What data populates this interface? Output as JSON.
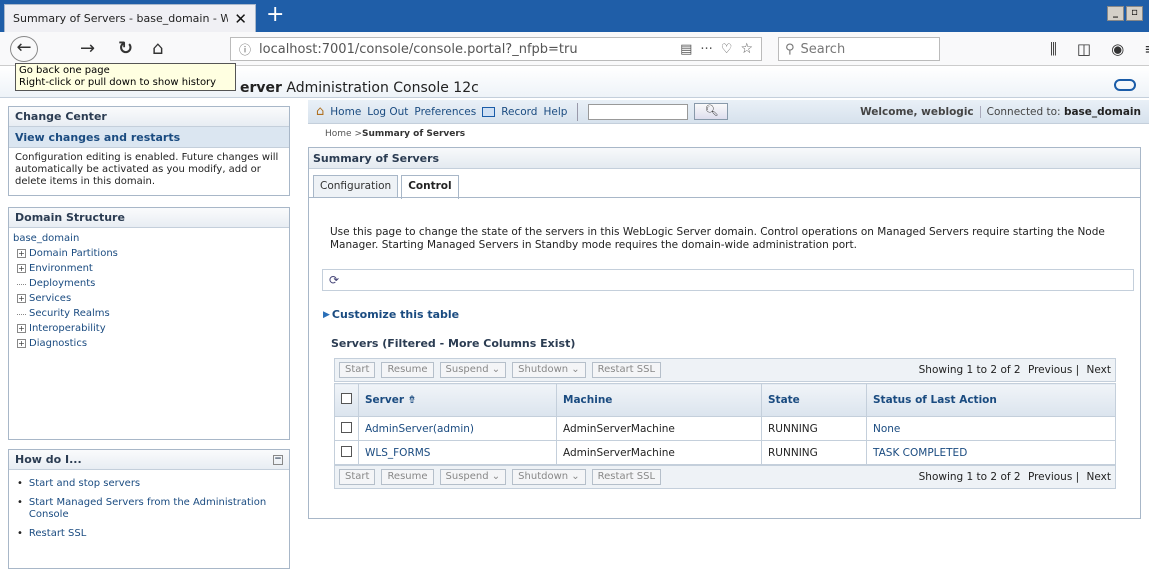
{
  "browser": {
    "tab_title": "Summary of Servers - base_domain - W",
    "url": "localhost:7001/console/console.portal?_nfpb=tru",
    "search_placeholder": "Search",
    "tooltip_line1": "Go back one page",
    "tooltip_line2": "Right-click or pull down to show history"
  },
  "header": {
    "title_bold": "erver",
    "title_rest": " Administration Console 12c"
  },
  "change_center": {
    "title": "Change Center",
    "view_link": "View changes and restarts",
    "text": "Configuration editing is enabled. Future changes will automatically be activated as you modify, add or delete items in this domain."
  },
  "domain_structure": {
    "title": "Domain Structure",
    "root": "base_domain",
    "items": [
      {
        "label": "Domain Partitions",
        "expandable": true
      },
      {
        "label": "Environment",
        "expandable": true
      },
      {
        "label": "Deployments",
        "expandable": false
      },
      {
        "label": "Services",
        "expandable": true
      },
      {
        "label": "Security Realms",
        "expandable": false
      },
      {
        "label": "Interoperability",
        "expandable": true
      },
      {
        "label": "Diagnostics",
        "expandable": true
      }
    ]
  },
  "how_do_i": {
    "title": "How do I...",
    "items": [
      "Start and stop servers",
      "Start Managed Servers from the Administration Console",
      "Restart SSL"
    ]
  },
  "toolbar": {
    "home": "Home",
    "logout": "Log Out",
    "preferences": "Preferences",
    "record": "Record",
    "help": "Help",
    "welcome": "Welcome, weblogic",
    "connected_label": "Connected to: ",
    "connected_domain": "base_domain"
  },
  "breadcrumb": {
    "home": "Home >",
    "current": "Summary of Servers"
  },
  "main": {
    "title": "Summary of Servers",
    "tabs": [
      "Configuration",
      "Control"
    ],
    "intro": "Use this page to change the state of the servers in this WebLogic Server domain. Control operations on Managed Servers require starting the Node Manager. Starting Managed Servers in Standby mode requires the domain-wide administration port.",
    "customize": "Customize this table",
    "table_title": "Servers (Filtered - More Columns Exist)",
    "buttons": {
      "start": "Start",
      "resume": "Resume",
      "suspend": "Suspend ⌄",
      "shutdown": "Shutdown ⌄",
      "restart_ssl": "Restart SSL"
    },
    "paging": {
      "showing": "Showing 1 to 2 of 2",
      "previous": "Previous",
      "next": "Next"
    },
    "columns": [
      "Server ⇮",
      "Machine",
      "State",
      "Status of Last Action"
    ],
    "rows": [
      {
        "server": "AdminServer(admin)",
        "machine": "AdminServerMachine",
        "state": "RUNNING",
        "status": "None"
      },
      {
        "server": "WLS_FORMS",
        "machine": "AdminServerMachine",
        "state": "RUNNING",
        "status": "TASK COMPLETED"
      }
    ]
  }
}
